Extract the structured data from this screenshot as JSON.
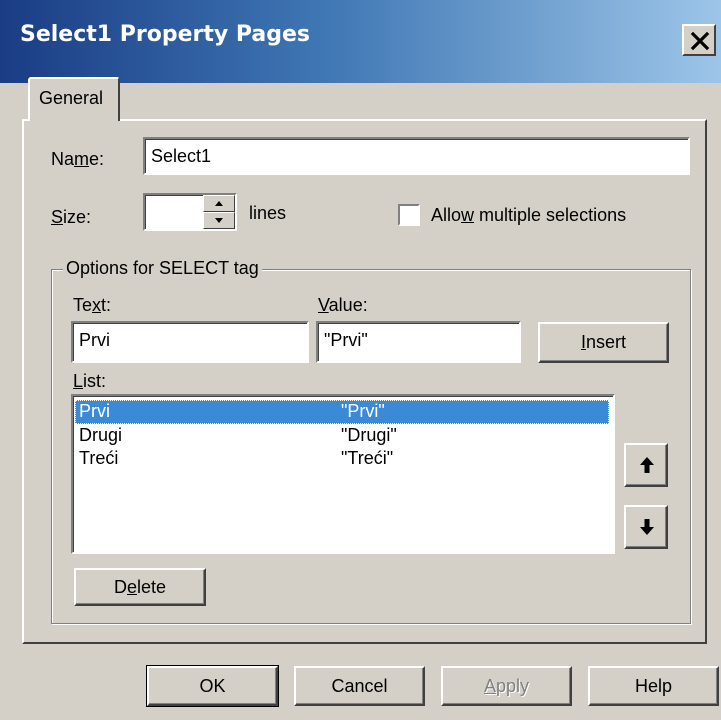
{
  "window": {
    "title": "Select1 Property Pages"
  },
  "tabs": [
    {
      "label": "General"
    }
  ],
  "general": {
    "name_label_pre": "Na",
    "name_label_acc": "m",
    "name_label_post": "e:",
    "name_value": "Select1",
    "size_label_acc": "S",
    "size_label_post": "ize:",
    "size_value": "",
    "size_unit": "lines",
    "allow_label_pre": "Allo",
    "allow_label_acc": "w",
    "allow_label_post": " multiple selections",
    "allow_checked": false
  },
  "options": {
    "group_title": "Options for SELECT tag",
    "text_label_pre": "Te",
    "text_label_acc": "x",
    "text_label_post": "t:",
    "text_value": "Prvi",
    "value_label_acc": "V",
    "value_label_post": "alue:",
    "value_value": "\"Prvi\"",
    "insert_pre": "",
    "insert_acc": "I",
    "insert_post": "nsert",
    "list_label_acc": "L",
    "list_label_post": "ist:",
    "list_items": [
      {
        "text": "Prvi",
        "value": "\"Prvi\"",
        "selected": true
      },
      {
        "text": "Drugi",
        "value": "\"Drugi\"",
        "selected": false
      },
      {
        "text": "Treći",
        "value": "\"Treći\"",
        "selected": false
      }
    ],
    "delete_pre": "D",
    "delete_acc": "e",
    "delete_post": "lete",
    "move_up_icon": "arrow-up-icon",
    "move_down_icon": "arrow-down-icon"
  },
  "footer": {
    "ok": "OK",
    "cancel": "Cancel",
    "apply_acc": "A",
    "apply_post": "pply",
    "help": "Help"
  },
  "colors": {
    "selection": "#3a8ad8",
    "face": "#d4d0c8"
  }
}
